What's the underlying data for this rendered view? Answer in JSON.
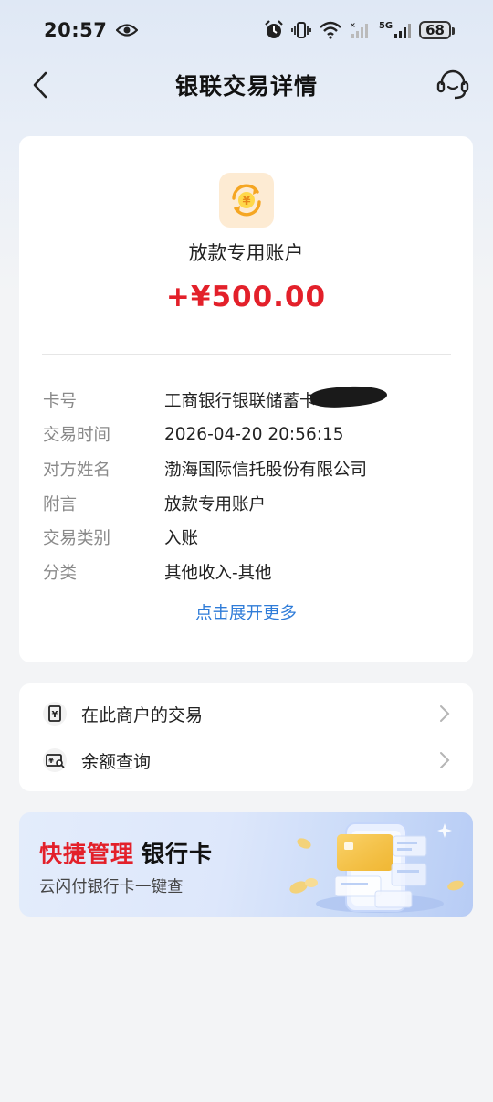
{
  "status_bar": {
    "time": "20:57",
    "network": "5G",
    "battery": "68"
  },
  "nav": {
    "title": "银联交易详情"
  },
  "transaction": {
    "merchant_name": "放款专用账户",
    "amount": "+¥500.00",
    "amount_color": "#e3202a",
    "rows": [
      {
        "label": "卡号",
        "value": "工商银行银联储蓄卡"
      },
      {
        "label": "交易时间",
        "value": "2026-04-20 20:56:15"
      },
      {
        "label": "对方姓名",
        "value": "渤海国际信托股份有限公司"
      },
      {
        "label": "附言",
        "value": "放款专用账户"
      },
      {
        "label": "交易类别",
        "value": "入账"
      },
      {
        "label": "分类",
        "value": "其他收入-其他"
      }
    ],
    "expand_link": "点击展开更多"
  },
  "menu": {
    "items": [
      {
        "label": "在此商户的交易",
        "icon": "receipt-yen-icon"
      },
      {
        "label": "余额查询",
        "icon": "card-search-icon"
      }
    ]
  },
  "banner": {
    "title_highlight": "快捷管理",
    "title_rest": "银行卡",
    "subtitle": "云闪付银行卡一键查"
  },
  "colors": {
    "accent_red": "#e3202a",
    "link_blue": "#2f7cd8",
    "icon_bg": "#fdebd3",
    "icon_gold": "#f5a623"
  }
}
